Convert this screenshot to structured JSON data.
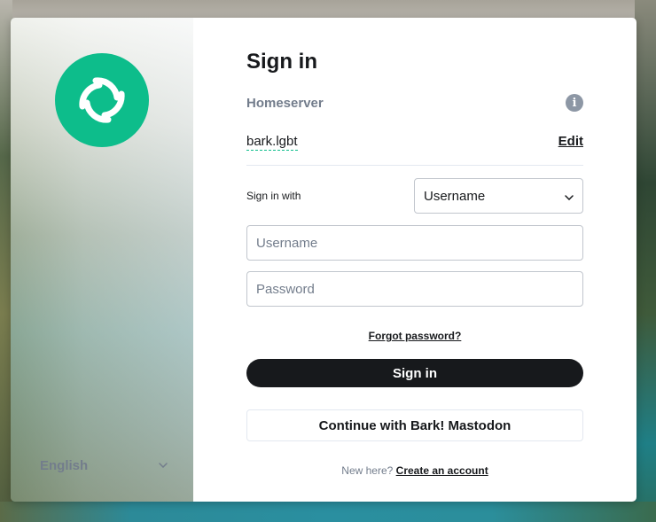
{
  "page": {
    "title": "Sign in"
  },
  "homeserver": {
    "label": "Homeserver",
    "value": "bark.lgbt",
    "edit_label": "Edit",
    "info_icon": "info-icon"
  },
  "signin_with": {
    "label": "Sign in with",
    "selected": "Username"
  },
  "fields": {
    "username_placeholder": "Username",
    "password_placeholder": "Password"
  },
  "links": {
    "forgot_password": "Forgot password?",
    "new_here": "New here?",
    "create_account": "Create an account"
  },
  "buttons": {
    "sign_in": "Sign in",
    "sso": "Continue with Bark! Mastodon"
  },
  "language": {
    "selected": "English"
  },
  "colors": {
    "accent": "#0dbd8b",
    "primary_text": "#17191c",
    "secondary_text": "#737d8c",
    "button_dark": "#17191c"
  }
}
